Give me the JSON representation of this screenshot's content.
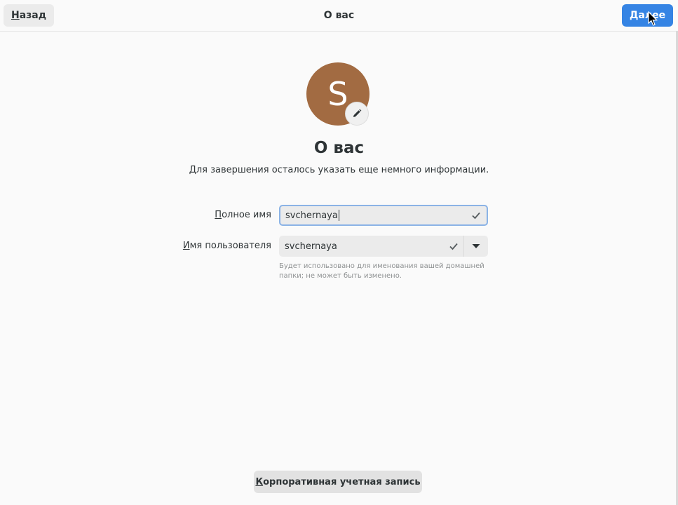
{
  "header": {
    "title": "О вас",
    "back_label_accel": "Н",
    "back_label_rest": "азад",
    "next_label_accel": "Д",
    "next_label_rest": "алее"
  },
  "avatar": {
    "letter": "S",
    "color": "#a26b42",
    "edit_icon": "pencil-icon"
  },
  "main": {
    "title": "О вас",
    "subtitle": "Для завершения осталось указать еще немного информации."
  },
  "form": {
    "fullname_label_accel": "П",
    "fullname_label_rest": "олное имя",
    "fullname_value": "svchernaya",
    "username_label_accel": "И",
    "username_label_rest": "мя пользователя",
    "username_value": "svchernaya",
    "username_hint": "Будет использовано для именования вашей домашней папки; не может быть изменено."
  },
  "footer": {
    "enterprise_label_accel": "К",
    "enterprise_label_rest": "орпоративная учетная запись"
  },
  "colors": {
    "accent": "#3584e4",
    "focus_border": "#8bb3e6",
    "avatar": "#a26b42"
  }
}
